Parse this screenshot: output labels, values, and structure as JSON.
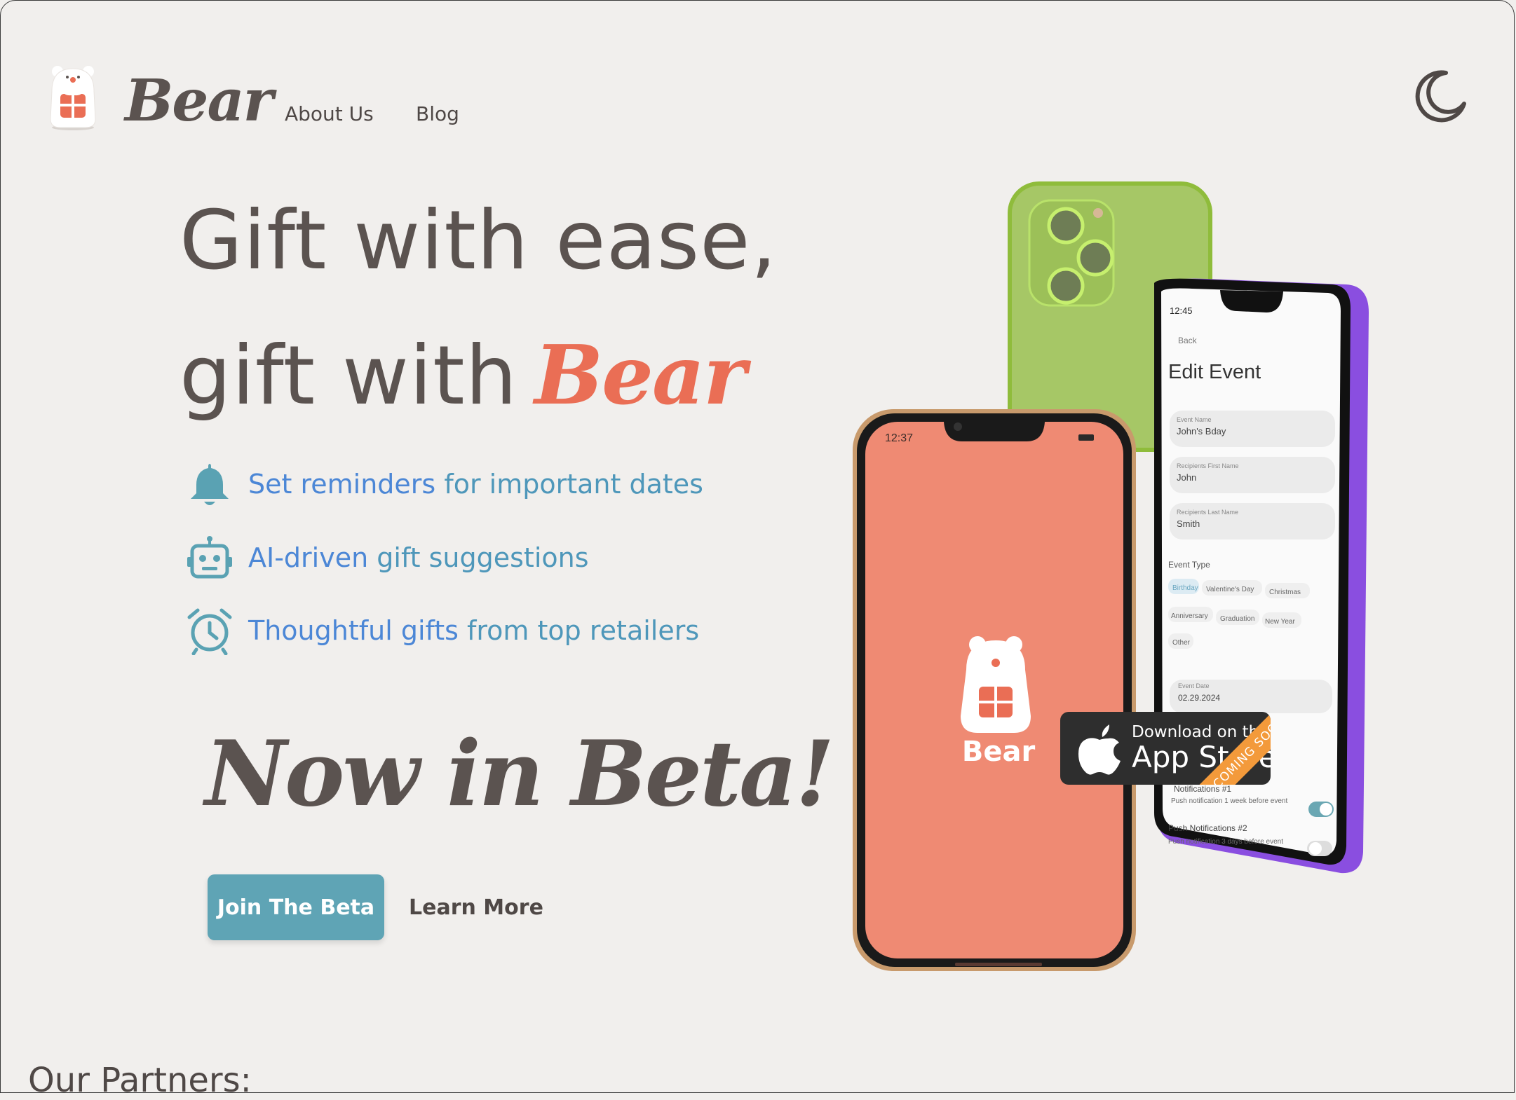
{
  "brand": {
    "name": "Bear",
    "accent": "#ea6e55",
    "text_color": "#5b5350",
    "teal": "#5fa4b5"
  },
  "nav": {
    "about": "About Us",
    "blog": "Blog",
    "theme_icon": "moon-icon"
  },
  "hero": {
    "line1": "Gift with ease,",
    "line2": "gift with",
    "brand": "Bear"
  },
  "features": [
    {
      "icon": "bell-icon",
      "highlight": "Set reminders",
      "rest": "for important dates"
    },
    {
      "icon": "robot-icon",
      "highlight": "AI-driven",
      "rest": "gift suggestions"
    },
    {
      "icon": "alarm-clock-icon",
      "highlight": "Thoughtful gifts",
      "rest": "from top retailers"
    }
  ],
  "beta_text": "Now in Beta!",
  "cta": {
    "join": "Join The Beta",
    "learn": "Learn More"
  },
  "partners_heading": "Our Partners:",
  "phone_front": {
    "time": "12:37",
    "app_name": "Bear"
  },
  "phone_back": {
    "time": "12:45",
    "back": "Back",
    "title": "Edit Event",
    "event_name_label": "Event Name",
    "event_name_value": "John's Bday",
    "first_name_label": "Recipients First Name",
    "first_name_value": "John",
    "last_name_label": "Recipients Last Name",
    "last_name_value": "Smith",
    "event_type_label": "Event Type",
    "event_types": [
      "Birthday",
      "Valentine's Day",
      "Christmas",
      "Anniversary",
      "Graduation",
      "New Year",
      "Other"
    ],
    "event_date_label": "Event Date",
    "event_date_value": "02.29.2024",
    "notif1_title": "Notifications #1",
    "notif1_desc": "Push notification 1 week before event",
    "notif2_title": "Push Notifications #2",
    "notif2_desc": "Push notification 3 days before event"
  },
  "app_store": {
    "small": "Download on the",
    "big": "App Store",
    "ribbon": "COMING SOON"
  }
}
